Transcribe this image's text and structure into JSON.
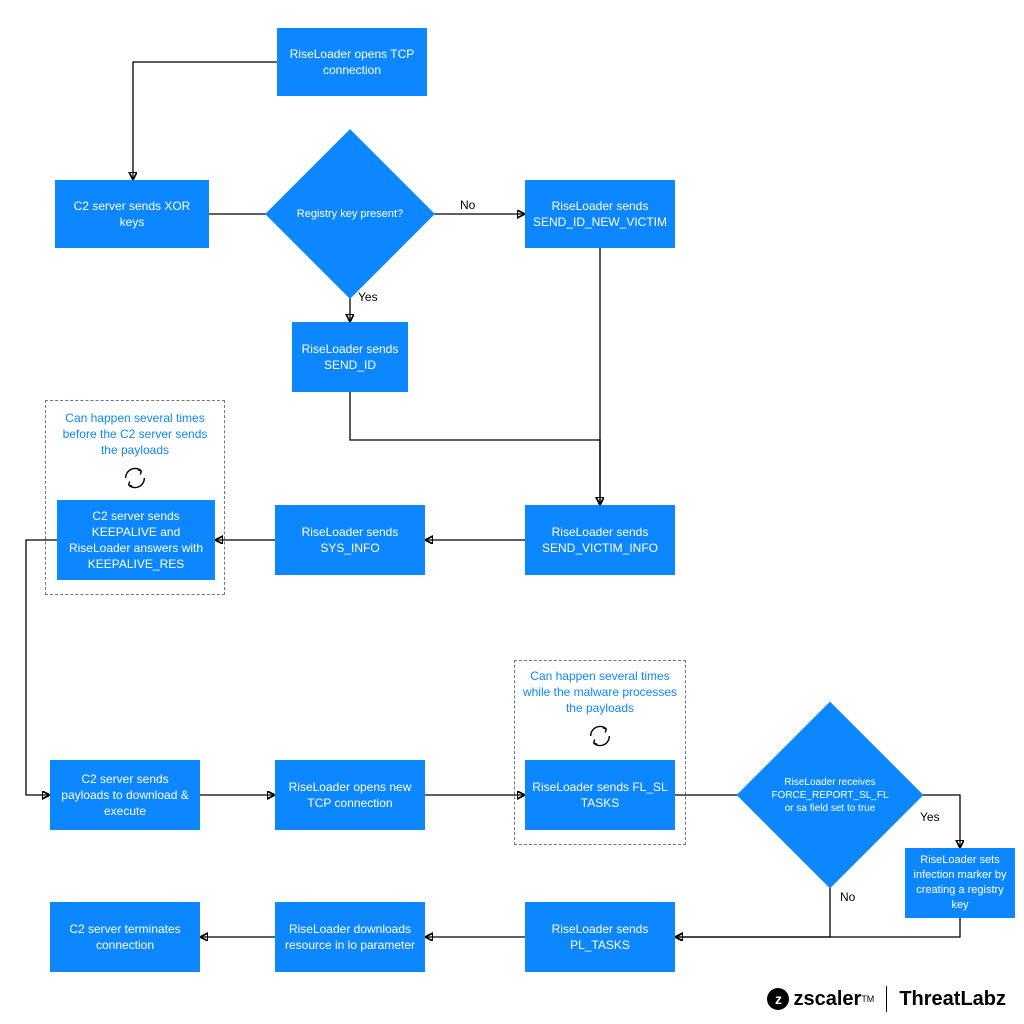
{
  "nodes": {
    "open_tcp": "RiseLoader opens TCP connection",
    "xor_keys": "C2 server sends XOR keys",
    "registry_q": "Registry key present?",
    "send_id_new": "RiseLoader sends SEND_ID_NEW_VICTIM",
    "send_id": "RiseLoader sends SEND_ID",
    "send_victim_info": "RiseLoader sends SEND_VICTIM_INFO",
    "sys_info": "RiseLoader sends SYS_INFO",
    "keepalive": "C2 server sends KEEPALIVE and RiseLoader answers with KEEPALIVE_RES",
    "payloads": "C2 server sends payloads to download & execute",
    "new_tcp": "RiseLoader opens new TCP connection",
    "fl_sl_tasks": "RiseLoader sends FL_SL TASKS",
    "force_report": "RiseLoader receives FORCE_REPORT_SL_FL or sa field set to true",
    "set_marker": "RiseLoader sets infection marker by creating a registry key",
    "pl_tasks": "RiseLoader sends PL_TASKS",
    "download_lo": "RiseLoader downloads resource in lo parameter",
    "terminate": "C2 server terminates connection"
  },
  "edges": {
    "registry_no": "No",
    "registry_yes": "Yes",
    "force_yes": "Yes",
    "force_no": "No"
  },
  "captions": {
    "loop1": "Can happen several times before the C2 server sends the payloads",
    "loop2": "Can happen several times while the malware processes the payloads"
  },
  "footer": {
    "brand1": "zscaler",
    "brand2_a": "Threat",
    "brand2_b": "Lab",
    "brand2_c": "z",
    "tm": "TM"
  }
}
